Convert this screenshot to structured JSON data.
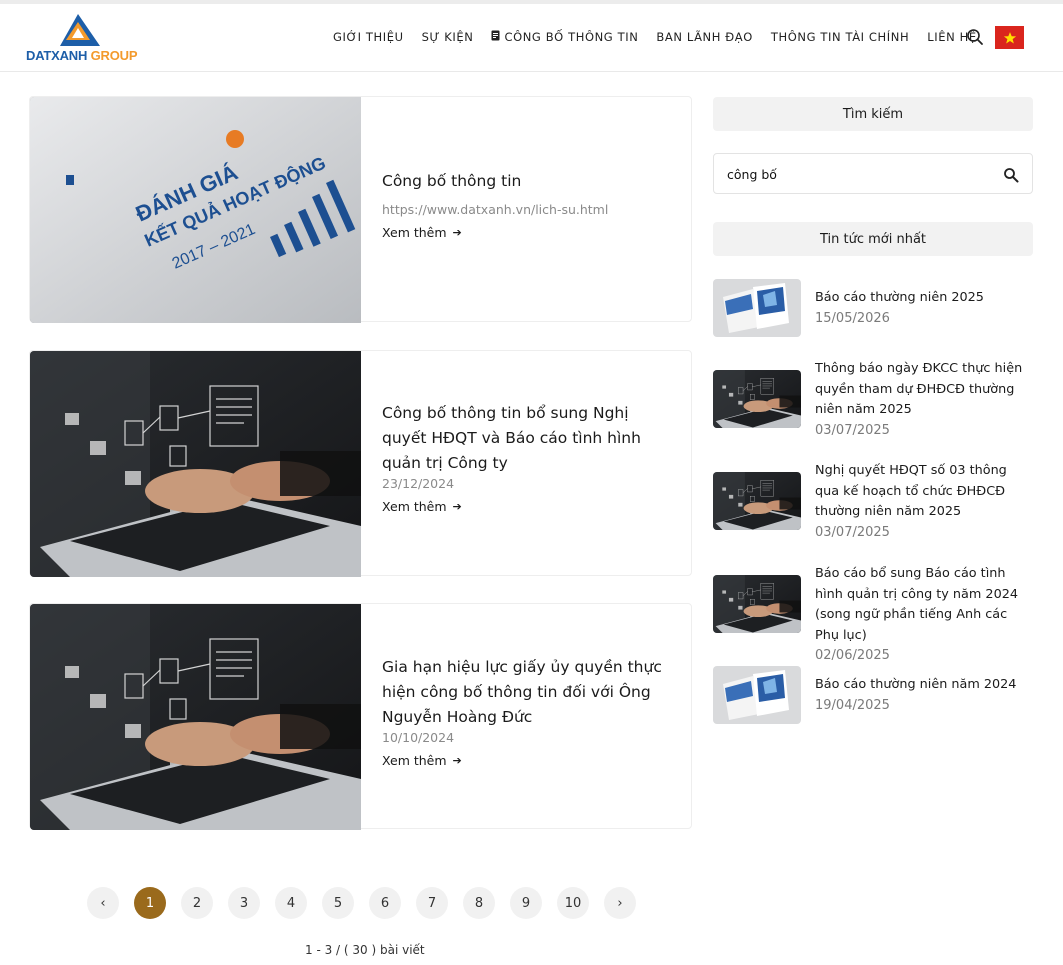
{
  "header": {
    "logo_text_main": "DATXANH",
    "logo_text_group": "GROUP",
    "nav": [
      {
        "label": "GIỚI THIỆU"
      },
      {
        "label": "SỰ KIỆN"
      },
      {
        "label": "CÔNG BỐ THÔNG TIN",
        "icon": "document-icon"
      },
      {
        "label": "BAN LÃNH ĐẠO"
      },
      {
        "label": "THÔNG TIN TÀI CHÍNH"
      },
      {
        "label": "LIÊN HỆ"
      }
    ],
    "search_icon": "search-icon",
    "language_flag": "vietnam-flag-icon"
  },
  "articles": [
    {
      "title": "Công bố thông tin",
      "subtitle": "https://www.datxanh.vn/lich-su.html",
      "read_more": "Xem thêm",
      "image": "report-book",
      "image_text": [
        "ĐÁNH GIÁ",
        "KẾT QUẢ HOẠT ĐỘNG",
        "2017 – 2021"
      ]
    },
    {
      "title": "Công bố thông tin bổ sung Nghị quyết HĐQT và Báo cáo tình hình quản trị Công ty",
      "subtitle": "23/12/2024",
      "read_more": "Xem thêm",
      "image": "laptop-typing"
    },
    {
      "title": "Gia hạn hiệu lực giấy ủy quyền thực hiện công bố thông tin đối với Ông Nguyễn Hoàng Đức",
      "subtitle": "10/10/2024",
      "read_more": "Xem thêm",
      "image": "laptop-typing"
    }
  ],
  "pagination": {
    "prev": "‹",
    "next": "›",
    "pages": [
      "1",
      "2",
      "3",
      "4",
      "5",
      "6",
      "7",
      "8",
      "9",
      "10"
    ],
    "active": "1",
    "summary": "1 - 3 / ( 30 ) bài viết"
  },
  "sidebar": {
    "search_heading": "Tìm kiếm",
    "search_value": "công bố",
    "news_heading": "Tin tức mới nhất",
    "news": [
      {
        "title": "Báo cáo thường niên 2025",
        "date": "15/05/2026",
        "image": "annual-report"
      },
      {
        "title": "Thông báo ngày ĐKCC thực hiện quyền tham dự ĐHĐCĐ thường niên năm 2025",
        "date": "03/07/2025",
        "image": "laptop-typing"
      },
      {
        "title": "Nghị quyết HĐQT số 03 thông qua kế hoạch tổ chức ĐHĐCĐ thường niên năm 2025",
        "date": "03/07/2025",
        "image": "laptop-typing"
      },
      {
        "title": "Báo cáo bổ sung Báo cáo tình hình quản trị công ty năm 2024 (song ngữ phần tiếng Anh các Phụ lục)",
        "date": "02/06/2025",
        "image": "laptop-typing"
      },
      {
        "title": "Báo cáo thường niên năm 2024",
        "date": "19/04/2025",
        "image": "annual-report"
      }
    ]
  },
  "colors": {
    "accent": "#9a6a1c",
    "brand_blue": "#1d5ea8",
    "brand_orange": "#f39a2c",
    "flag_red": "#da251d",
    "flag_star": "#ffde00"
  }
}
